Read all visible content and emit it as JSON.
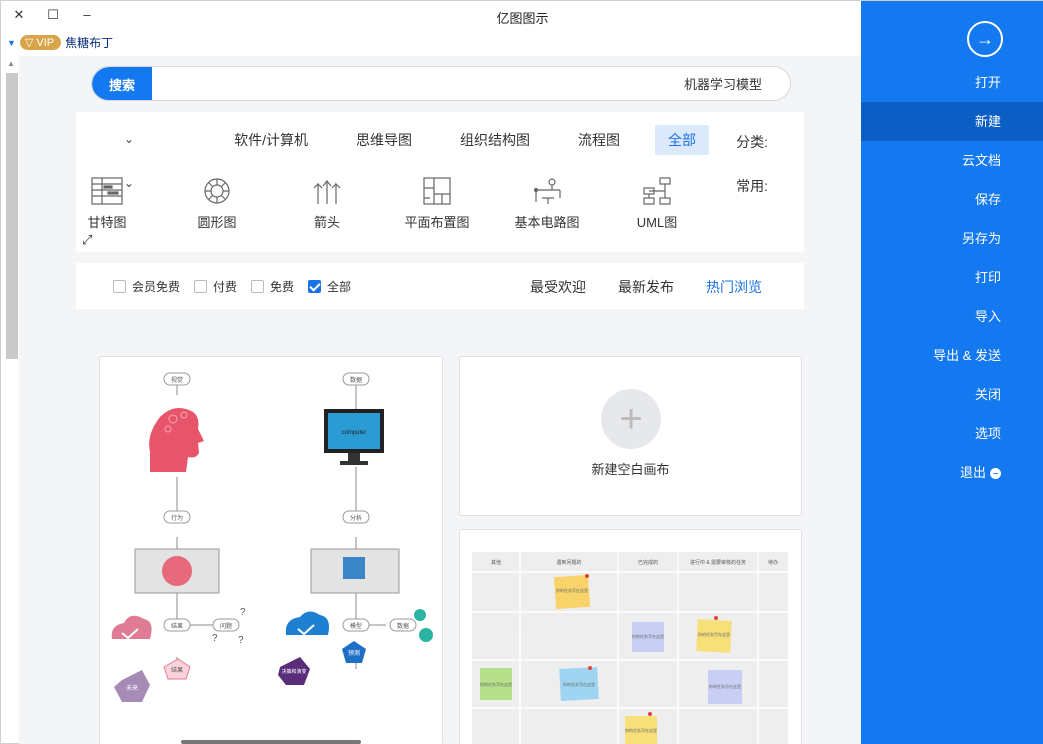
{
  "window": {
    "title": "亿图图示",
    "controls": {
      "close": "✕",
      "maximize": "☐",
      "minimize": "–"
    }
  },
  "user": {
    "name": "焦糖布丁",
    "vip": "VIP"
  },
  "search": {
    "button": "搜索",
    "value": "机器学习模型"
  },
  "filters": {
    "category_label": "分类:",
    "categories": [
      {
        "label": "全部",
        "active": true
      },
      {
        "label": "流程图",
        "active": false
      },
      {
        "label": "组织结构图",
        "active": false
      },
      {
        "label": "思维导图",
        "active": false
      },
      {
        "label": "软件/计算机",
        "active": false
      }
    ],
    "common_label": "常用:",
    "common": [
      {
        "label": "UML图",
        "icon": "uml-icon"
      },
      {
        "label": "基本电路图",
        "icon": "circuit-icon"
      },
      {
        "label": "平面布置图",
        "icon": "floorplan-icon"
      },
      {
        "label": "箭头",
        "icon": "arrows-icon"
      },
      {
        "label": "圆形图",
        "icon": "circle-diagram-icon"
      },
      {
        "label": "甘特图",
        "icon": "gantt-icon"
      }
    ]
  },
  "sort": {
    "tabs": [
      {
        "label": "热门浏览",
        "active": true
      },
      {
        "label": "最新发布",
        "active": false
      },
      {
        "label": "最受欢迎",
        "active": false
      }
    ],
    "price": [
      {
        "label": "全部",
        "checked": true
      },
      {
        "label": "免费",
        "checked": false
      },
      {
        "label": "付费",
        "checked": false
      },
      {
        "label": "会员免费",
        "checked": false
      }
    ]
  },
  "blank_canvas": {
    "label": "新建空白画布"
  },
  "ml_diagram": {
    "left_branch": [
      "视觉",
      "行为",
      "结果",
      "问题",
      "未来"
    ],
    "right_branch": [
      "数据",
      "分析",
      "模型",
      "预测",
      "决策和演变",
      "数据"
    ],
    "monitor_text": "computer"
  },
  "kanban": {
    "headers": [
      "待办",
      "进行中 & 需要审核的任务",
      "已完成的",
      "遇到问题的",
      "其他"
    ],
    "note_text": "你的任务写在这里"
  },
  "sidebar": {
    "items": [
      {
        "label": "打开",
        "active": false
      },
      {
        "label": "新建",
        "active": true
      },
      {
        "label": "云文档",
        "active": false
      },
      {
        "label": "保存",
        "active": false
      },
      {
        "label": "另存为",
        "active": false
      },
      {
        "label": "打印",
        "active": false
      },
      {
        "label": "导入",
        "active": false
      },
      {
        "label": "导出 & 发送",
        "active": false
      },
      {
        "label": "关闭",
        "active": false
      },
      {
        "label": "选项",
        "active": false
      },
      {
        "label": "退出",
        "active": false
      }
    ]
  },
  "colors": {
    "accent": "#1478f0",
    "sidebar_active": "#0b5fc4",
    "vip": "#d9a54a"
  }
}
